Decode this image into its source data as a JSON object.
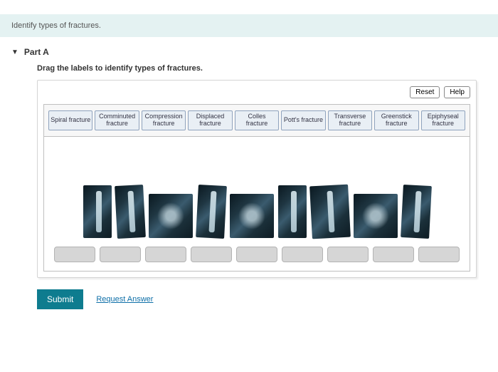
{
  "instruction": "Identify types of fractures.",
  "part": {
    "label": "Part A",
    "prompt": "Drag the labels to identify types of fractures."
  },
  "controls": {
    "reset": "Reset",
    "help": "Help"
  },
  "labels": [
    "Spiral fracture",
    "Comminuted fracture",
    "Compression fracture",
    "Displaced fracture",
    "Colles fracture",
    "Pott's fracture",
    "Transverse fracture",
    "Greenstick fracture",
    "Epiphyseal fracture"
  ],
  "actions": {
    "submit": "Submit",
    "request_answer": "Request Answer"
  }
}
